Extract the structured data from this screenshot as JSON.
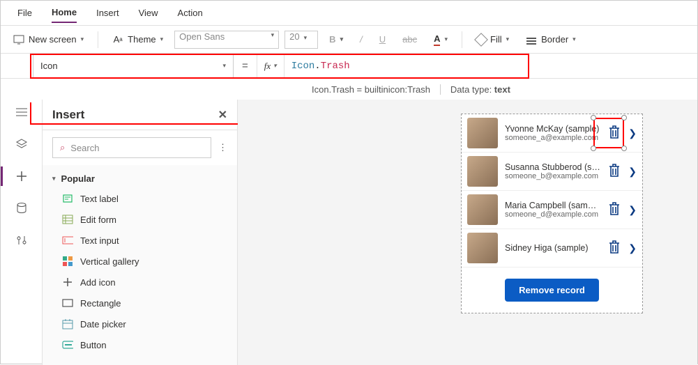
{
  "menubar": {
    "items": [
      "File",
      "Home",
      "Insert",
      "View",
      "Action"
    ],
    "active": 1
  },
  "toolbar": {
    "new_screen": "New screen",
    "theme": "Theme",
    "font": "Open Sans",
    "size": "20",
    "fill": "Fill",
    "border": "Border"
  },
  "formula": {
    "property": "Icon",
    "fx": "fx",
    "value_type": "Icon",
    "value_member": "Trash",
    "hint_eval": "Icon.Trash  =  builtinicon:Trash",
    "hint_type_label": "Data type: ",
    "hint_type_value": "text"
  },
  "panel": {
    "title": "Insert",
    "search_placeholder": "Search",
    "group": "Popular",
    "items": [
      {
        "icon": "textlabel-icon",
        "label": "Text label"
      },
      {
        "icon": "editform-icon",
        "label": "Edit form"
      },
      {
        "icon": "textinput-icon",
        "label": "Text input"
      },
      {
        "icon": "gallery-icon",
        "label": "Vertical gallery"
      },
      {
        "icon": "addicon-icon",
        "label": "Add icon"
      },
      {
        "icon": "rectangle-icon",
        "label": "Rectangle"
      },
      {
        "icon": "datepicker-icon",
        "label": "Date picker"
      },
      {
        "icon": "button-icon",
        "label": "Button"
      }
    ]
  },
  "canvas": {
    "gallery": [
      {
        "name": "Yvonne McKay (sample)",
        "email": "someone_a@example.com",
        "selected": true
      },
      {
        "name": "Susanna Stubberod (sample)",
        "email": "someone_b@example.com"
      },
      {
        "name": "Maria Campbell (sample)",
        "email": "someone_d@example.com"
      },
      {
        "name": "Sidney Higa (sample)",
        "email": ""
      }
    ],
    "button": "Remove record"
  }
}
